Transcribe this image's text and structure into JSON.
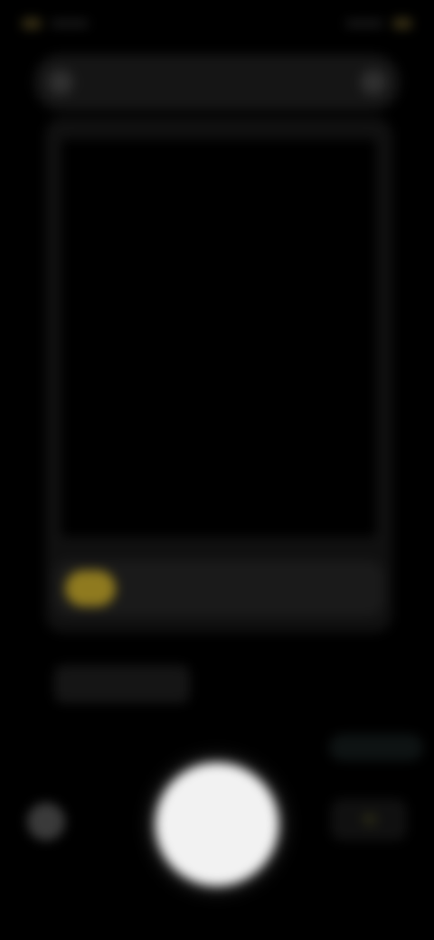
{
  "status": {
    "left": "",
    "right": ""
  },
  "toolbar": {
    "title": "",
    "back_icon": "back-icon",
    "more_icon": "more-icon"
  },
  "viewfinder": {
    "detect_label": "",
    "caption": ""
  },
  "controls": {
    "mode_label": "",
    "gallery_icon": "gallery-icon",
    "shutter_icon": "shutter-icon",
    "switch_icon": "switch-camera-icon"
  },
  "colors": {
    "accent": "#8f7a1f",
    "background": "#000000"
  }
}
